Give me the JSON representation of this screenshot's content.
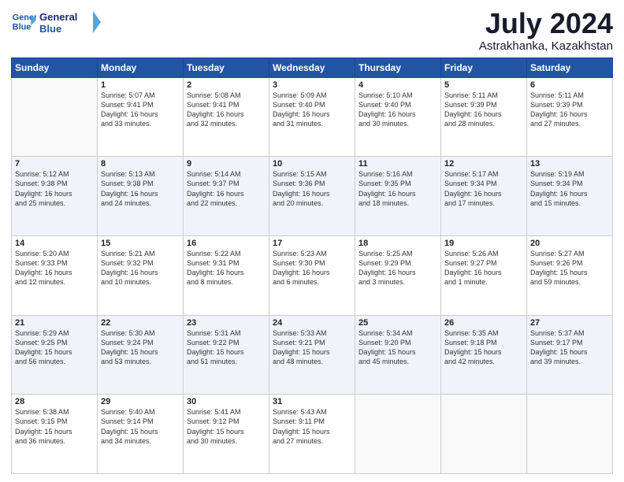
{
  "header": {
    "logo_line1": "General",
    "logo_line2": "Blue",
    "title": "July 2024",
    "subtitle": "Astrakhanka, Kazakhstan"
  },
  "weekdays": [
    "Sunday",
    "Monday",
    "Tuesday",
    "Wednesday",
    "Thursday",
    "Friday",
    "Saturday"
  ],
  "weeks": [
    [
      {
        "day": "",
        "info": ""
      },
      {
        "day": "1",
        "info": "Sunrise: 5:07 AM\nSunset: 9:41 PM\nDaylight: 16 hours\nand 33 minutes."
      },
      {
        "day": "2",
        "info": "Sunrise: 5:08 AM\nSunset: 9:41 PM\nDaylight: 16 hours\nand 32 minutes."
      },
      {
        "day": "3",
        "info": "Sunrise: 5:09 AM\nSunset: 9:40 PM\nDaylight: 16 hours\nand 31 minutes."
      },
      {
        "day": "4",
        "info": "Sunrise: 5:10 AM\nSunset: 9:40 PM\nDaylight: 16 hours\nand 30 minutes."
      },
      {
        "day": "5",
        "info": "Sunrise: 5:11 AM\nSunset: 9:39 PM\nDaylight: 16 hours\nand 28 minutes."
      },
      {
        "day": "6",
        "info": "Sunrise: 5:11 AM\nSunset: 9:39 PM\nDaylight: 16 hours\nand 27 minutes."
      }
    ],
    [
      {
        "day": "7",
        "info": "Sunrise: 5:12 AM\nSunset: 9:38 PM\nDaylight: 16 hours\nand 25 minutes."
      },
      {
        "day": "8",
        "info": "Sunrise: 5:13 AM\nSunset: 9:38 PM\nDaylight: 16 hours\nand 24 minutes."
      },
      {
        "day": "9",
        "info": "Sunrise: 5:14 AM\nSunset: 9:37 PM\nDaylight: 16 hours\nand 22 minutes."
      },
      {
        "day": "10",
        "info": "Sunrise: 5:15 AM\nSunset: 9:36 PM\nDaylight: 16 hours\nand 20 minutes."
      },
      {
        "day": "11",
        "info": "Sunrise: 5:16 AM\nSunset: 9:35 PM\nDaylight: 16 hours\nand 18 minutes."
      },
      {
        "day": "12",
        "info": "Sunrise: 5:17 AM\nSunset: 9:34 PM\nDaylight: 16 hours\nand 17 minutes."
      },
      {
        "day": "13",
        "info": "Sunrise: 5:19 AM\nSunset: 9:34 PM\nDaylight: 16 hours\nand 15 minutes."
      }
    ],
    [
      {
        "day": "14",
        "info": "Sunrise: 5:20 AM\nSunset: 9:33 PM\nDaylight: 16 hours\nand 12 minutes."
      },
      {
        "day": "15",
        "info": "Sunrise: 5:21 AM\nSunset: 9:32 PM\nDaylight: 16 hours\nand 10 minutes."
      },
      {
        "day": "16",
        "info": "Sunrise: 5:22 AM\nSunset: 9:31 PM\nDaylight: 16 hours\nand 8 minutes."
      },
      {
        "day": "17",
        "info": "Sunrise: 5:23 AM\nSunset: 9:30 PM\nDaylight: 16 hours\nand 6 minutes."
      },
      {
        "day": "18",
        "info": "Sunrise: 5:25 AM\nSunset: 9:29 PM\nDaylight: 16 hours\nand 3 minutes."
      },
      {
        "day": "19",
        "info": "Sunrise: 5:26 AM\nSunset: 9:27 PM\nDaylight: 16 hours\nand 1 minute."
      },
      {
        "day": "20",
        "info": "Sunrise: 5:27 AM\nSunset: 9:26 PM\nDaylight: 15 hours\nand 59 minutes."
      }
    ],
    [
      {
        "day": "21",
        "info": "Sunrise: 5:29 AM\nSunset: 9:25 PM\nDaylight: 15 hours\nand 56 minutes."
      },
      {
        "day": "22",
        "info": "Sunrise: 5:30 AM\nSunset: 9:24 PM\nDaylight: 15 hours\nand 53 minutes."
      },
      {
        "day": "23",
        "info": "Sunrise: 5:31 AM\nSunset: 9:22 PM\nDaylight: 15 hours\nand 51 minutes."
      },
      {
        "day": "24",
        "info": "Sunrise: 5:33 AM\nSunset: 9:21 PM\nDaylight: 15 hours\nand 48 minutes."
      },
      {
        "day": "25",
        "info": "Sunrise: 5:34 AM\nSunset: 9:20 PM\nDaylight: 15 hours\nand 45 minutes."
      },
      {
        "day": "26",
        "info": "Sunrise: 5:35 AM\nSunset: 9:18 PM\nDaylight: 15 hours\nand 42 minutes."
      },
      {
        "day": "27",
        "info": "Sunrise: 5:37 AM\nSunset: 9:17 PM\nDaylight: 15 hours\nand 39 minutes."
      }
    ],
    [
      {
        "day": "28",
        "info": "Sunrise: 5:38 AM\nSunset: 9:15 PM\nDaylight: 15 hours\nand 36 minutes."
      },
      {
        "day": "29",
        "info": "Sunrise: 5:40 AM\nSunset: 9:14 PM\nDaylight: 15 hours\nand 34 minutes."
      },
      {
        "day": "30",
        "info": "Sunrise: 5:41 AM\nSunset: 9:12 PM\nDaylight: 15 hours\nand 30 minutes."
      },
      {
        "day": "31",
        "info": "Sunrise: 5:43 AM\nSunset: 9:11 PM\nDaylight: 15 hours\nand 27 minutes."
      },
      {
        "day": "",
        "info": ""
      },
      {
        "day": "",
        "info": ""
      },
      {
        "day": "",
        "info": ""
      }
    ]
  ]
}
